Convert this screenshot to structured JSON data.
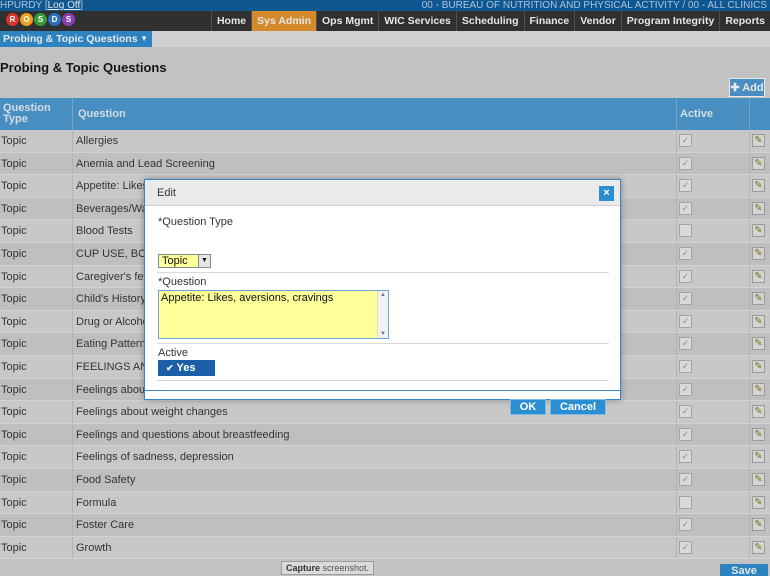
{
  "topbar": {
    "user": "HPURDY",
    "logoff": "Log Off",
    "agency": "00 - BUREAU OF NUTRITION AND PHYSICAL ACTIVITY / 00 - ALL CLINICS"
  },
  "logo": {
    "letters": [
      "R",
      "O",
      "S",
      "D",
      "S"
    ],
    "colors": [
      "#d9342b",
      "#f0a020",
      "#3a9a3a",
      "#2a6fc0",
      "#8a3fb0"
    ]
  },
  "nav": [
    "Home",
    "Sys Admin",
    "Ops Mgmt",
    "WIC Services",
    "Scheduling",
    "Finance",
    "Vendor",
    "Program Integrity",
    "Reports"
  ],
  "nav_active": "Sys Admin",
  "breadcrumb": {
    "label": "Probing & Topic Questions"
  },
  "page_title": "Probing & Topic Questions",
  "add_button": "Add",
  "grid": {
    "col_type": "Question Type",
    "col_question": "Question",
    "col_active": "Active",
    "rows": [
      {
        "type": "Topic",
        "question": "Allergies",
        "active": true
      },
      {
        "type": "Topic",
        "question": "Anemia and Lead Screening",
        "active": true
      },
      {
        "type": "Topic",
        "question": "Appetite: Likes,",
        "active": true
      },
      {
        "type": "Topic",
        "question": "Beverages/Wat",
        "active": true
      },
      {
        "type": "Topic",
        "question": "Blood Tests",
        "active": false
      },
      {
        "type": "Topic",
        "question": "CUP USE, BOT",
        "active": true
      },
      {
        "type": "Topic",
        "question": "Caregiver's fee",
        "active": true
      },
      {
        "type": "Topic",
        "question": "Child's History o",
        "active": true
      },
      {
        "type": "Topic",
        "question": "Drug or Alcoho",
        "active": true
      },
      {
        "type": "Topic",
        "question": "Eating Patterns",
        "active": true
      },
      {
        "type": "Topic",
        "question": "FEELINGS AND",
        "active": true
      },
      {
        "type": "Topic",
        "question": "Feelings about",
        "active": true
      },
      {
        "type": "Topic",
        "question": "Feelings about weight changes",
        "active": true
      },
      {
        "type": "Topic",
        "question": "Feelings and questions about breastfeeding",
        "active": true
      },
      {
        "type": "Topic",
        "question": "Feelings of sadness, depression",
        "active": true
      },
      {
        "type": "Topic",
        "question": "Food Safety",
        "active": true
      },
      {
        "type": "Topic",
        "question": "Formula",
        "active": false
      },
      {
        "type": "Topic",
        "question": "Foster Care",
        "active": true
      },
      {
        "type": "Topic",
        "question": "Growth",
        "active": true
      }
    ]
  },
  "tooltip": {
    "bold": "Capture",
    "rest": " screenshot."
  },
  "save_button": "Save",
  "dialog": {
    "title": "Edit",
    "close": "×",
    "question_type_label": "*Question Type",
    "question_type_value": "Topic",
    "question_label": "*Question",
    "question_value": "Appetite: Likes, aversions, cravings",
    "active_label": "Active",
    "active_value": "Yes",
    "ok": "OK",
    "cancel": "Cancel"
  }
}
